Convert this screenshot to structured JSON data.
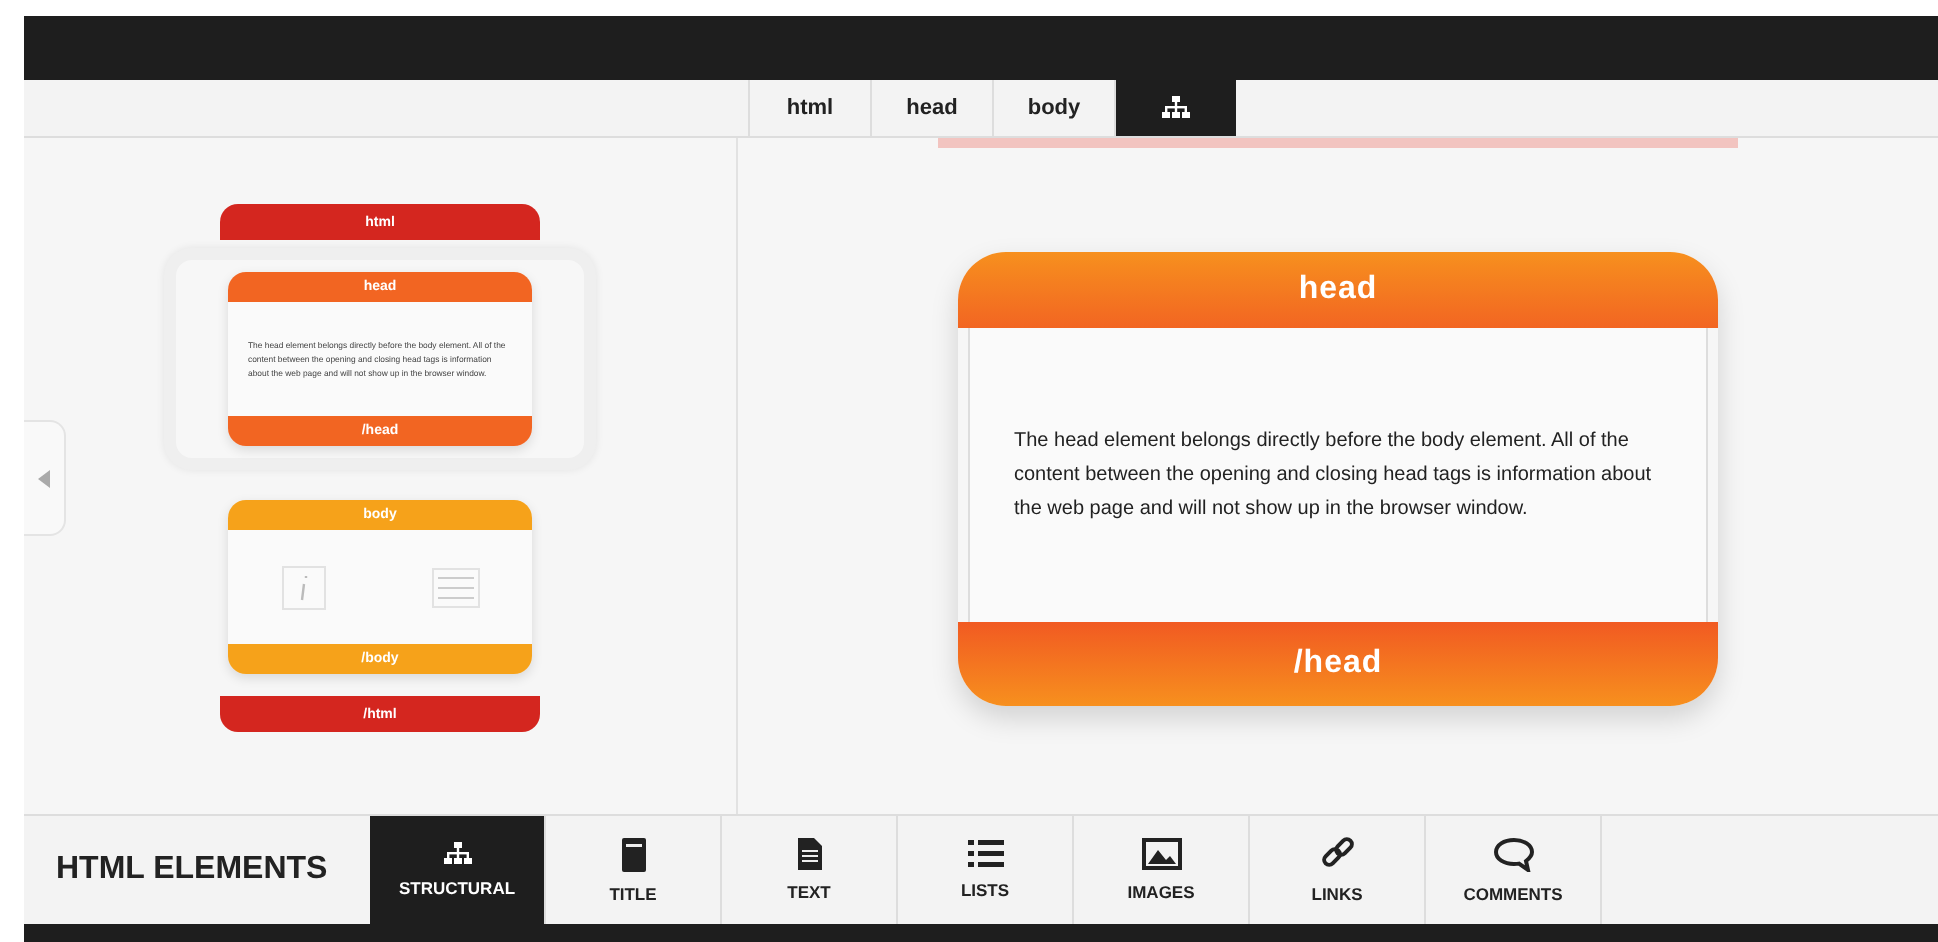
{
  "tabs": [
    {
      "kind": "text",
      "label": "html",
      "selected": false
    },
    {
      "kind": "text",
      "label": "head",
      "selected": false
    },
    {
      "kind": "text",
      "label": "body",
      "selected": false
    },
    {
      "kind": "icon",
      "selected": true
    }
  ],
  "outline": [
    {
      "open": "html",
      "close": "/html",
      "color": "#d4261f",
      "children": [
        {
          "kind": "text",
          "open": "head",
          "close": "/head",
          "color": "#f26522",
          "selected": true,
          "text": "The head element belongs directly before the body element. All of the content between the opening and closing head tags is information about the web page and will not show up in the browser window."
        },
        {
          "kind": "icons",
          "open": "body",
          "close": "/body",
          "color": "#f6a21a",
          "selected": false
        }
      ]
    }
  ],
  "detail": {
    "open": "head",
    "close": "/head",
    "text": "The head element belongs directly before the body element. All of the content between the opening and closing head tags is information about the web page and will not show up in the browser window."
  },
  "footer": {
    "title": "HTML ELEMENTS",
    "items": [
      {
        "label": "STRUCTURAL",
        "selected": true
      },
      {
        "label": "TITLE",
        "selected": false
      },
      {
        "label": "TEXT",
        "selected": false
      },
      {
        "label": "LISTS",
        "selected": false
      },
      {
        "label": "IMAGES",
        "selected": false
      },
      {
        "label": "LINKS",
        "selected": false
      },
      {
        "label": "COMMENTS",
        "selected": false
      }
    ]
  }
}
